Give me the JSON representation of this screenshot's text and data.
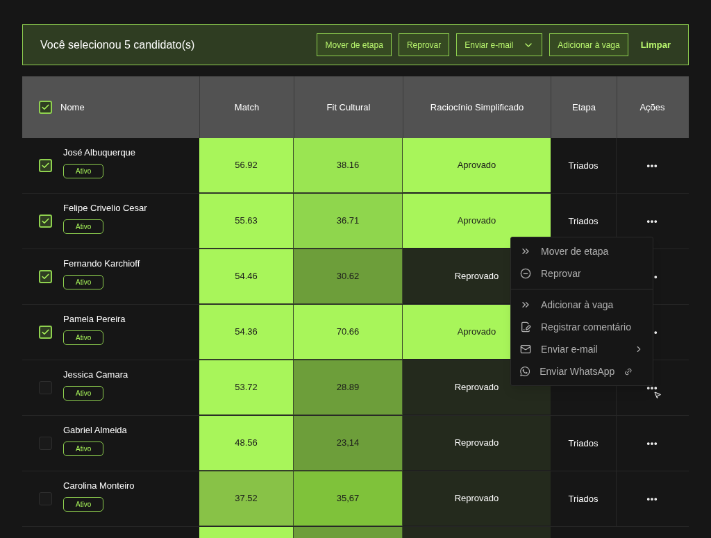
{
  "bulk_bar": {
    "title": "Você selecionou 5 candidato(s)",
    "buttons": [
      {
        "label": "Mover de etapa",
        "kind": "plain"
      },
      {
        "label": "Reprovar",
        "kind": "plain"
      },
      {
        "label": "Enviar e-mail",
        "kind": "dropdown"
      },
      {
        "label": "Adicionar à vaga",
        "kind": "plain"
      }
    ],
    "link": "Limpar"
  },
  "table": {
    "select_all": {
      "checked": true
    },
    "columns": [
      "Nome",
      "Match",
      "Fit Cultural",
      "Raciocínio Simplificado",
      "Etapa",
      "Ações"
    ],
    "rows": [
      {
        "checked": true,
        "name": "José Albuquerque",
        "badge": "Ativo",
        "match": {
          "value": "56.92",
          "color": "#a8f55a"
        },
        "fit": {
          "value": "38.16",
          "color": "#9ae552"
        },
        "reasoning": {
          "label": "Aprovado",
          "kind": "approved"
        },
        "stage": "Triados"
      },
      {
        "checked": true,
        "name": "Felipe Crivelio Cesar",
        "badge": "Ativo",
        "match": {
          "value": "55.63",
          "color": "#a8f55a"
        },
        "fit": {
          "value": "36.71",
          "color": "#8fd64d"
        },
        "reasoning": {
          "label": "Aprovado",
          "kind": "approved"
        },
        "stage": "Triados"
      },
      {
        "checked": true,
        "name": "Fernando Karchioff",
        "badge": "Ativo",
        "match": {
          "value": "54.46",
          "color": "#a8f55a"
        },
        "fit": {
          "value": "30.62",
          "color": "#6d9e3a"
        },
        "reasoning": {
          "label": "Reprovado",
          "kind": "rejected"
        }
      },
      {
        "checked": true,
        "name": "Pamela Pereira",
        "badge": "Ativo",
        "match": {
          "value": "54.36",
          "color": "#a8f55a"
        },
        "fit": {
          "value": "70.66",
          "color": "#a8f55a"
        },
        "reasoning": {
          "label": "Aprovado",
          "kind": "approved"
        }
      },
      {
        "checked": false,
        "name": "Jessica Camara",
        "badge": "Ativo",
        "match": {
          "value": "53.72",
          "color": "#a8f55a"
        },
        "fit": {
          "value": "28.89",
          "color": "#6d9e3a"
        },
        "reasoning": {
          "label": "Reprovado",
          "kind": "rejected"
        }
      },
      {
        "checked": false,
        "name": "Gabriel Almeida",
        "badge": "Ativo",
        "match": {
          "value": "48.56",
          "color": "#a8f55a"
        },
        "fit": {
          "value": "23,14",
          "color": "#6d9e3a"
        },
        "reasoning": {
          "label": "Reprovado",
          "kind": "rejected"
        },
        "stage": "Triados"
      },
      {
        "checked": false,
        "name": "Carolina Monteiro",
        "badge": "Ativo",
        "match": {
          "value": "37.52",
          "color": "#88c247"
        },
        "fit": {
          "value": "35,67",
          "color": "#7fc23a"
        },
        "reasoning": {
          "label": "Reprovado",
          "kind": "rejected"
        },
        "stage": "Triados"
      }
    ],
    "partial_row": {
      "match": {
        "color": "#a8f55a"
      },
      "fit": {
        "color": "#6d9e3a"
      }
    }
  },
  "context_menu": {
    "items": [
      {
        "kind": "move",
        "label": "Mover de etapa",
        "divider_before": false
      },
      {
        "kind": "reject",
        "label": "Reprovar",
        "divider_before": false
      },
      {
        "kind": "add",
        "label": "Adicionar à vaga",
        "divider_before": true
      },
      {
        "kind": "comment",
        "label": "Registrar comentário",
        "divider_before": false
      },
      {
        "kind": "email",
        "label": "Enviar e-mail",
        "divider_before": false
      },
      {
        "kind": "whatsapp",
        "label": "Enviar WhatsApp",
        "divider_before": false
      }
    ]
  }
}
